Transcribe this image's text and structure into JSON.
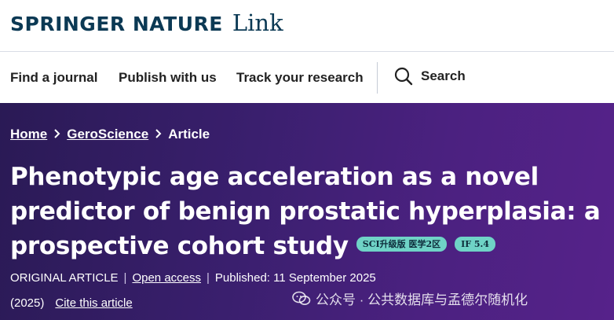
{
  "brand": {
    "logo_name": "SPRINGER NATURE",
    "logo_link": "Link"
  },
  "nav": {
    "items": [
      "Find a journal",
      "Publish with us",
      "Track your research"
    ],
    "search_label": "Search"
  },
  "breadcrumb": {
    "home": "Home",
    "journal": "GeroScience",
    "current": "Article"
  },
  "article": {
    "title": "Phenotypic age acceleration as a novel predictor of benign prostatic hyperplasia: a prospective cohort study",
    "badges": [
      "SCI升级版 医学2区",
      "IF 5.4"
    ],
    "type": "ORIGINAL ARTICLE",
    "access": "Open access",
    "published": "Published: 11 September 2025",
    "year": "(2025)",
    "cite": "Cite this article"
  },
  "watermark": {
    "text": "公众号 · 公共数据库与孟德尔随机化"
  },
  "colors": {
    "brand_blue": "#0b3954",
    "hero_bg": "#3a1f6e",
    "badge_bg": "#6fd3c6"
  },
  "icons": [
    "search-icon",
    "chevron-right-icon",
    "wechat-icon"
  ]
}
